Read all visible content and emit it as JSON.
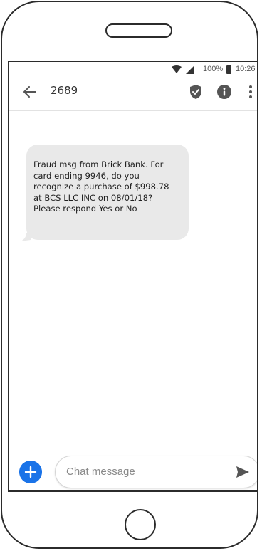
{
  "status_bar": {
    "battery_percent": "100%",
    "time": "10:26",
    "icons": [
      "wifi-icon",
      "signal-icon",
      "battery-icon"
    ]
  },
  "app_bar": {
    "title": "2689",
    "icons": [
      "back-arrow-icon",
      "shield-check-icon",
      "info-icon",
      "more-vert-icon"
    ]
  },
  "message": {
    "lines": [
      "Fraud msg from Brick Bank. For",
      "card ending 9946, do you",
      "recognize a purchase of $998.78",
      "at BCS LLC INC on 08/01/18?",
      "Please respond Yes or No"
    ]
  },
  "compose": {
    "placeholder": "Chat message",
    "icons": [
      "add-icon",
      "send-icon"
    ]
  },
  "colors": {
    "accent": "#1a73e8",
    "bubble": "#e9e9e9",
    "icon": "#555555"
  }
}
